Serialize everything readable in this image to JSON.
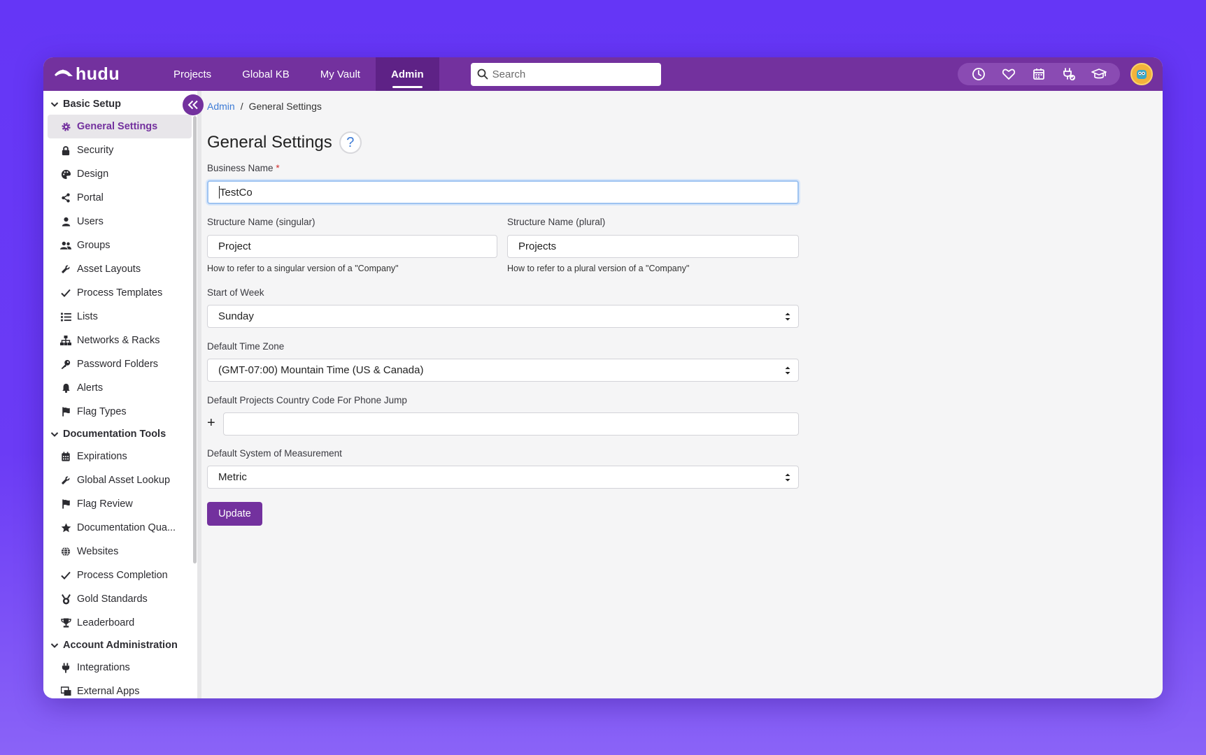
{
  "app": {
    "logo_text": "hudu",
    "nav": [
      "Projects",
      "Global KB",
      "My Vault",
      "Admin"
    ],
    "active_nav": "Admin",
    "search_placeholder": "Search"
  },
  "header_icons": [
    "clock-icon",
    "heart-icon",
    "calendar-icon",
    "plug-check-icon",
    "graduation-cap-icon"
  ],
  "sidebar": {
    "sections": [
      {
        "title": "Basic Setup",
        "items": [
          {
            "label": "General Settings",
            "icon": "gear-icon",
            "active": true
          },
          {
            "label": "Security",
            "icon": "lock-icon"
          },
          {
            "label": "Design",
            "icon": "palette-icon"
          },
          {
            "label": "Portal",
            "icon": "share-icon"
          },
          {
            "label": "Users",
            "icon": "user-icon"
          },
          {
            "label": "Groups",
            "icon": "users-icon"
          },
          {
            "label": "Asset Layouts",
            "icon": "wrench-icon"
          },
          {
            "label": "Process Templates",
            "icon": "check-icon"
          },
          {
            "label": "Lists",
            "icon": "list-icon"
          },
          {
            "label": "Networks & Racks",
            "icon": "network-icon"
          },
          {
            "label": "Password Folders",
            "icon": "key-icon"
          },
          {
            "label": "Alerts",
            "icon": "bell-icon"
          },
          {
            "label": "Flag Types",
            "icon": "flag-icon"
          }
        ]
      },
      {
        "title": "Documentation Tools",
        "items": [
          {
            "label": "Expirations",
            "icon": "calendar-icon"
          },
          {
            "label": "Global Asset Lookup",
            "icon": "wrench-icon"
          },
          {
            "label": "Flag Review",
            "icon": "flag-icon"
          },
          {
            "label": "Documentation Qua...",
            "icon": "star-icon"
          },
          {
            "label": "Websites",
            "icon": "globe-icon"
          },
          {
            "label": "Process Completion",
            "icon": "check-icon"
          },
          {
            "label": "Gold Standards",
            "icon": "medal-icon"
          },
          {
            "label": "Leaderboard",
            "icon": "trophy-icon"
          }
        ]
      },
      {
        "title": "Account Administration",
        "items": [
          {
            "label": "Integrations",
            "icon": "plug-icon"
          },
          {
            "label": "External Apps",
            "icon": "window-icon"
          }
        ]
      }
    ]
  },
  "breadcrumb": {
    "root": "Admin",
    "sep": "/",
    "current": "General Settings"
  },
  "page": {
    "title": "General Settings",
    "help_label": "?",
    "business_name_label": "Business Name",
    "required_mark": "*",
    "business_name_value": "TestCo",
    "structure_singular_label": "Structure Name (singular)",
    "structure_singular_value": "Project",
    "structure_singular_hint": "How to refer to a singular version of a \"Company\"",
    "structure_plural_label": "Structure Name (plural)",
    "structure_plural_value": "Projects",
    "structure_plural_hint": "How to refer to a plural version of a \"Company\"",
    "start_week_label": "Start of Week",
    "start_week_value": "Sunday",
    "timezone_label": "Default Time Zone",
    "timezone_value": "(GMT-07:00) Mountain Time (US & Canada)",
    "country_code_label": "Default Projects Country Code For Phone Jump",
    "country_code_prefix": "+",
    "country_code_value": "",
    "measurement_label": "Default System of Measurement",
    "measurement_value": "Metric",
    "update_label": "Update"
  }
}
